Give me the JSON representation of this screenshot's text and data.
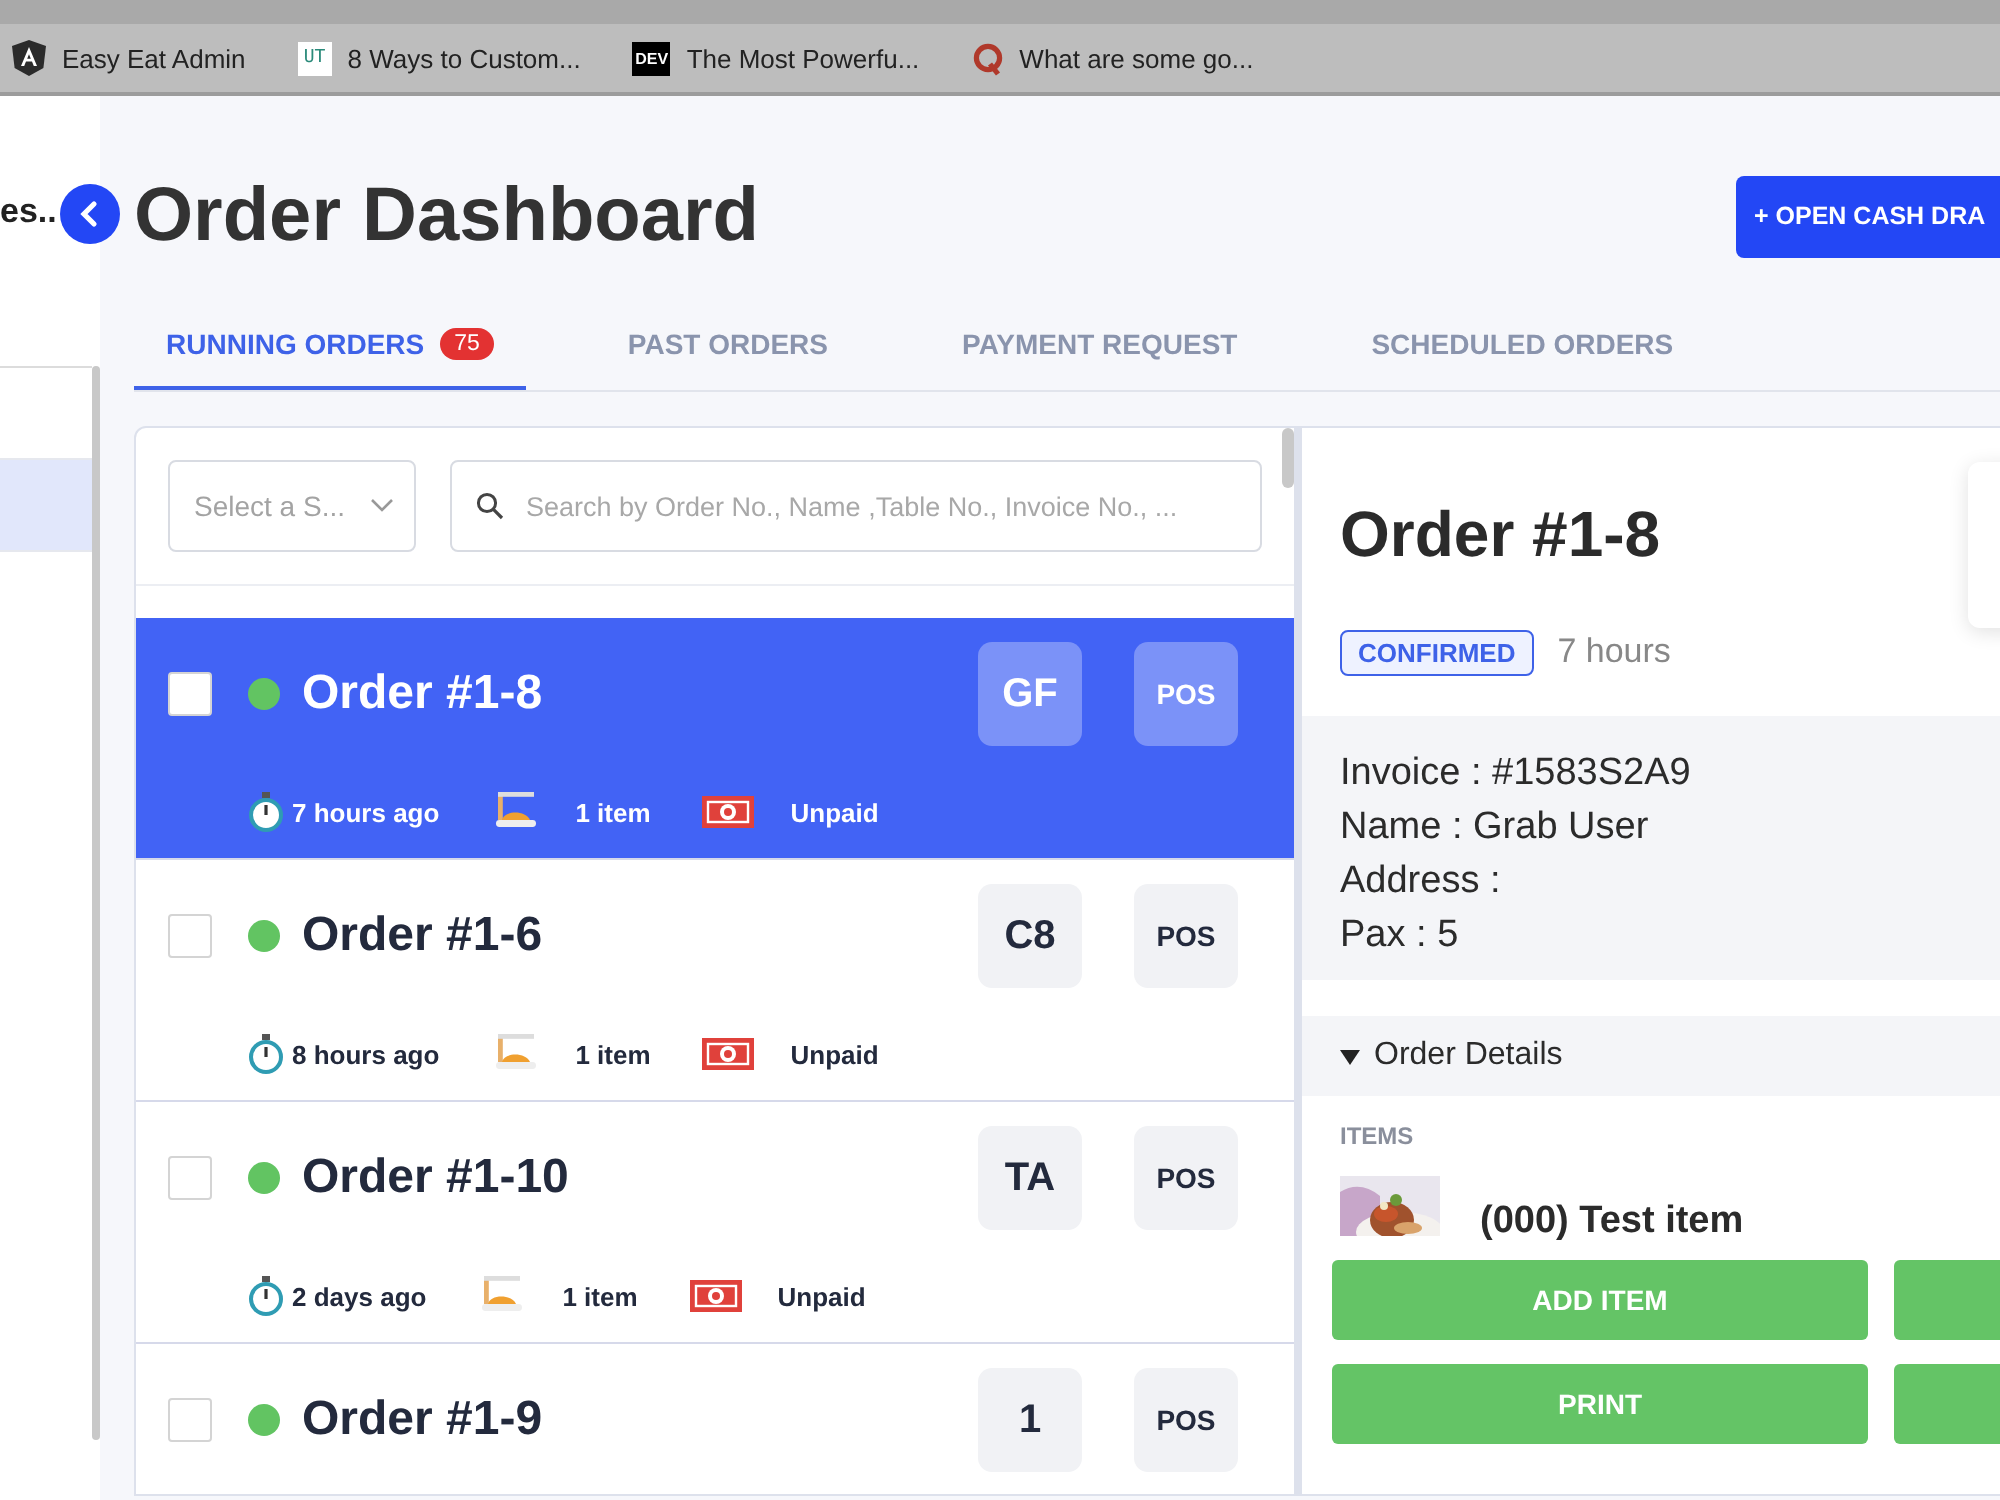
{
  "browser": {
    "bookmarks": [
      {
        "kind": "shield",
        "label": "Easy Eat Admin"
      },
      {
        "kind": "light-badge",
        "badge": "UT",
        "label": "8 Ways to Custom..."
      },
      {
        "kind": "dark-badge",
        "badge": "DEV",
        "label": "The Most Powerfu..."
      },
      {
        "kind": "ring",
        "label": "What are some go..."
      }
    ]
  },
  "sidebar": {
    "label": "es..",
    "items": [
      {
        "selected": false
      },
      {
        "selected": true
      }
    ]
  },
  "header": {
    "title": "Order Dashboard",
    "action": "+ OPEN CASH DRA"
  },
  "tabs": [
    {
      "label": "RUNNING ORDERS",
      "count": "75",
      "selected": true
    },
    {
      "label": "PAST ORDERS",
      "selected": false
    },
    {
      "label": "PAYMENT REQUEST",
      "selected": false
    },
    {
      "label": "SCHEDULED ORDERS",
      "selected": false
    }
  ],
  "filters": {
    "select_placeholder": "Select a S...",
    "search_placeholder": "Search by Order No., Name ,Table No., Invoice No., ..."
  },
  "orders": [
    {
      "title": "Order #1-8",
      "selected": true,
      "checked": false,
      "table": "GF",
      "source": "POS",
      "time": "7 hours ago",
      "items": "1 item",
      "payment": "Unpaid"
    },
    {
      "title": "Order #1-6",
      "selected": false,
      "checked": false,
      "table": "C8",
      "source": "POS",
      "time": "8 hours ago",
      "items": "1 item",
      "payment": "Unpaid"
    },
    {
      "title": "Order #1-10",
      "selected": false,
      "checked": false,
      "table": "TA",
      "source": "POS",
      "time": "2 days ago",
      "items": "1 item",
      "payment": "Unpaid"
    },
    {
      "title": "Order #1-9",
      "selected": false,
      "checked": false,
      "table": "1",
      "source": "POS"
    }
  ],
  "detail": {
    "title": "Order #1-8",
    "status": "CONFIRMED",
    "age": "7 hours",
    "info": [
      "Invoice : #1583S2A9",
      "Name : Grab User",
      "Address :",
      "Pax : 5"
    ],
    "section": {
      "label": "Order Details",
      "expanded": true
    },
    "items_label": "ITEMS",
    "items": [
      {
        "name": "(000) Test item"
      }
    ],
    "buttons": [
      {
        "kind": "full",
        "label": "ADD ITEM"
      },
      {
        "kind": "cut"
      },
      {
        "kind": "full",
        "label": "PRINT"
      },
      {
        "kind": "cut"
      }
    ]
  }
}
